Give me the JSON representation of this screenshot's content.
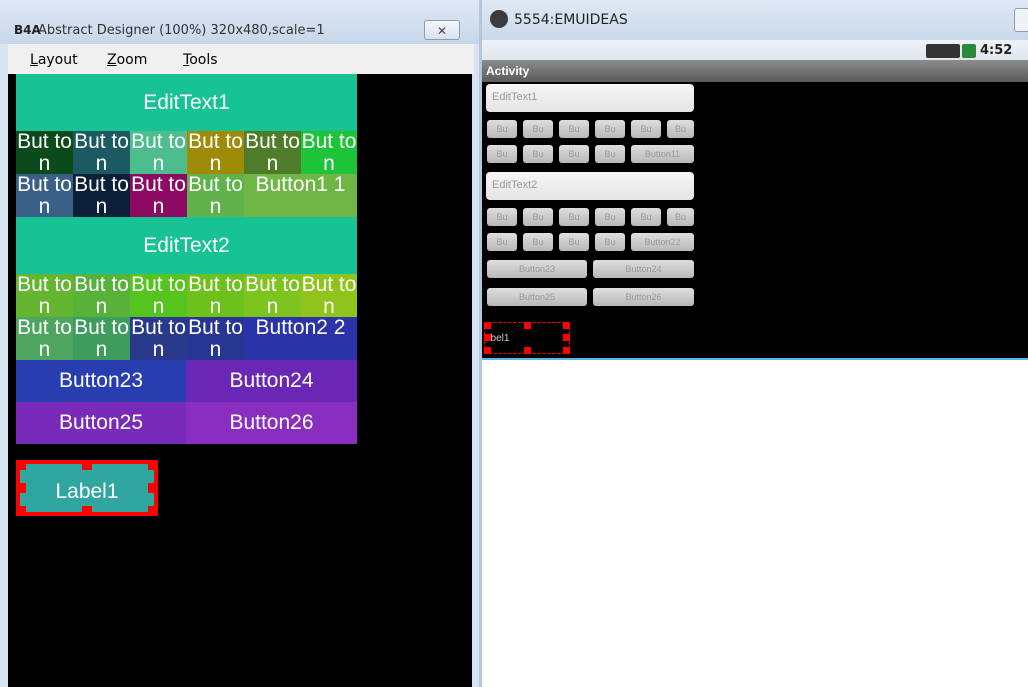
{
  "designer": {
    "logo": "B4A",
    "title": "Abstract Designer (100%) 320x480,scale=1",
    "close_glyph": "✕",
    "menu": [
      "Layout",
      "Zoom",
      "Tools"
    ],
    "views": {
      "edittext1": "EditText1",
      "edittext2": "EditText2",
      "row1": [
        "But ton",
        "But ton",
        "But ton",
        "But ton",
        "But ton",
        "But ton"
      ],
      "row2": [
        "But ton",
        "But ton",
        "But ton",
        "But ton",
        "Button1 1"
      ],
      "row3": [
        "But ton",
        "But ton",
        "But ton",
        "But ton",
        "But ton",
        "But ton"
      ],
      "row4": [
        "But ton",
        "But ton",
        "But ton",
        "But ton",
        "Button2 2"
      ],
      "button23": "Button23",
      "button24": "Button24",
      "button25": "Button25",
      "button26": "Button26",
      "label1": "Label1"
    }
  },
  "emulator": {
    "title": "5554:EMUIDEAS",
    "clock": "4:52",
    "activity": "Activity",
    "edittext1": "EditText1",
    "edittext2": "EditText2",
    "btn_short": "Bu",
    "button11": "Button11",
    "button22": "Button22",
    "button23": "Button23",
    "button24": "Button24",
    "button25": "Button25",
    "button26": "Button26",
    "label1": "abel1"
  }
}
